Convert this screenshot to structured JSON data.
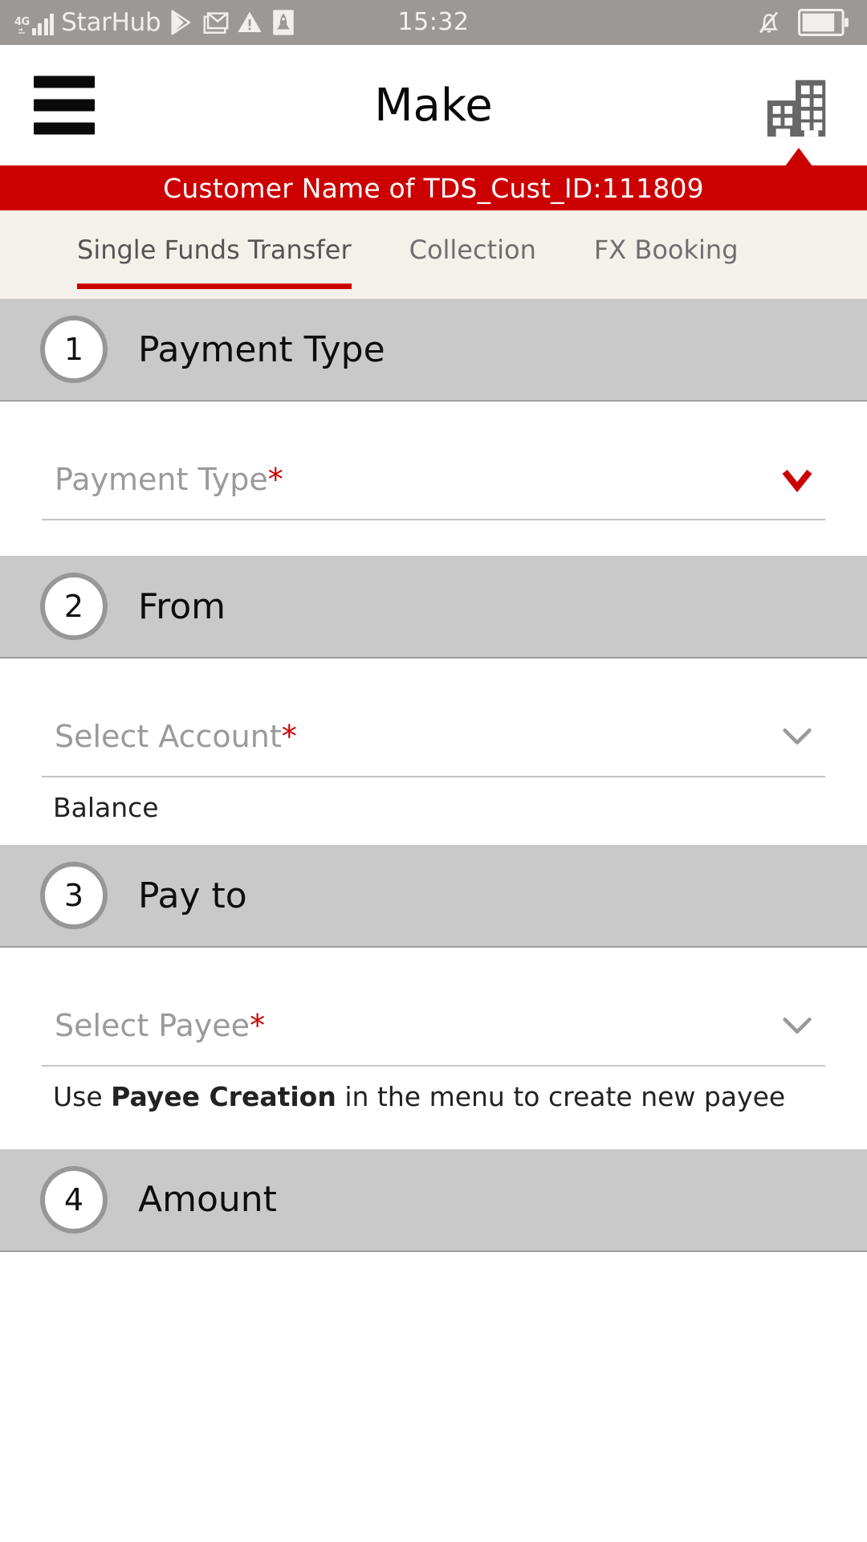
{
  "status_bar": {
    "network_type": "4G",
    "carrier": "StarHub",
    "time": "15:32",
    "left_icons": [
      "signal-icon",
      "playstore-icon",
      "gmail-icon",
      "warning-icon",
      "rocket-icon"
    ],
    "right_icons": [
      "bell-muted-icon",
      "battery-icon"
    ],
    "background": "#9b9895"
  },
  "header": {
    "menu_icon": "hamburger-icon",
    "title": "Make",
    "company_icon": "building-icon"
  },
  "banner": {
    "text": "Customer Name of TDS_Cust_ID:111809",
    "background": "#cc0000",
    "text_color": "#ffffff"
  },
  "tabs": {
    "background": "#f4f1ea",
    "active_index": 0,
    "accent": "#cc0000",
    "items": [
      {
        "label": "Single Funds Transfer"
      },
      {
        "label": "Collection"
      },
      {
        "label": "FX Booking"
      }
    ]
  },
  "sections": [
    {
      "number": "1",
      "title": "Payment Type",
      "field": {
        "placeholder": "Payment Type",
        "required_mark": "*",
        "value": "",
        "chevron": "chevron-down-icon",
        "chevron_color": "#cc0000"
      },
      "hint": null,
      "sublabel": null
    },
    {
      "number": "2",
      "title": "From",
      "field": {
        "placeholder": "Select Account",
        "required_mark": "*",
        "value": "",
        "chevron": "chevron-down-icon",
        "chevron_color": "#9a9a9a"
      },
      "hint": null,
      "sublabel": "Balance"
    },
    {
      "number": "3",
      "title": "Pay to",
      "field": {
        "placeholder": "Select Payee",
        "required_mark": "*",
        "value": "",
        "chevron": "chevron-down-icon",
        "chevron_color": "#9a9a9a"
      },
      "hint": {
        "prefix": "Use ",
        "emphasis": "Payee Creation",
        "suffix": " in the menu to create new payee"
      },
      "sublabel": null
    },
    {
      "number": "4",
      "title": "Amount",
      "field": null,
      "hint": null,
      "sublabel": null
    }
  ]
}
